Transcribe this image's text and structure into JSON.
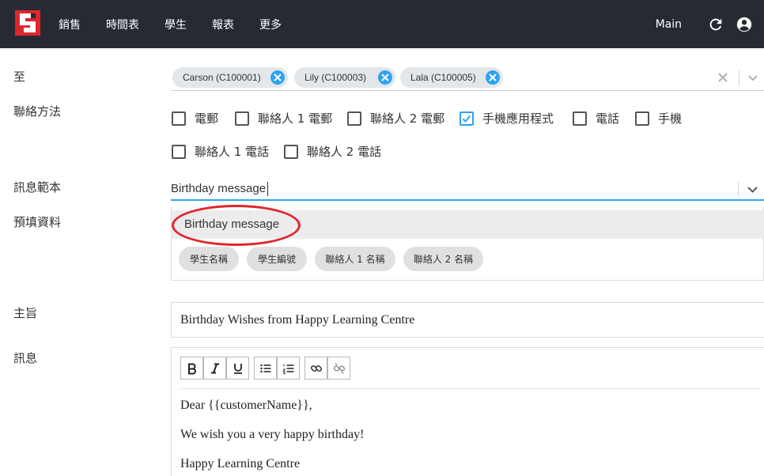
{
  "nav": {
    "items": [
      "銷售",
      "時間表",
      "學生",
      "報表",
      "更多"
    ],
    "right_label": "Main"
  },
  "colors": {
    "topbar": "#262b33",
    "accent": "#2ea3f2",
    "logo": "#e0252d",
    "annotation": "#e0252d"
  },
  "icons": {
    "logo": "logo-icon",
    "refresh": "refresh-icon",
    "account": "account-icon"
  },
  "form": {
    "to_label": "至",
    "recipients": [
      "Carson (C100001)",
      "Lily (C100003)",
      "Lala (C100005)"
    ],
    "contact_label": "聯絡方法",
    "contact_methods": [
      {
        "label": "電郵",
        "checked": false
      },
      {
        "label": "聯絡人 1 電郵",
        "checked": false
      },
      {
        "label": "聯絡人 2 電郵",
        "checked": false
      },
      {
        "label": "手機應用程式",
        "checked": true
      },
      {
        "label": "電話",
        "checked": false
      },
      {
        "label": "手機",
        "checked": false
      },
      {
        "label": "聯絡人 1 電話",
        "checked": false
      },
      {
        "label": "聯絡人 2 電話",
        "checked": false
      }
    ],
    "template_label": "訊息範本",
    "template_value": "Birthday message",
    "template_options": [
      "Birthday message"
    ],
    "prefill_label": "預填資料",
    "prefill_tags": [
      "學生名稱",
      "學生編號",
      "聯絡人 1 名稱",
      "聯絡人 2 名稱"
    ],
    "subject_label": "主旨",
    "subject_value": "Birthday Wishes from Happy Learning Centre",
    "message_label": "訊息",
    "message_lines": [
      "Dear {{customerName}},",
      "We wish you a very happy birthday!",
      "Happy Learning Centre"
    ],
    "editor_tools": [
      "B",
      "I",
      "U"
    ]
  }
}
